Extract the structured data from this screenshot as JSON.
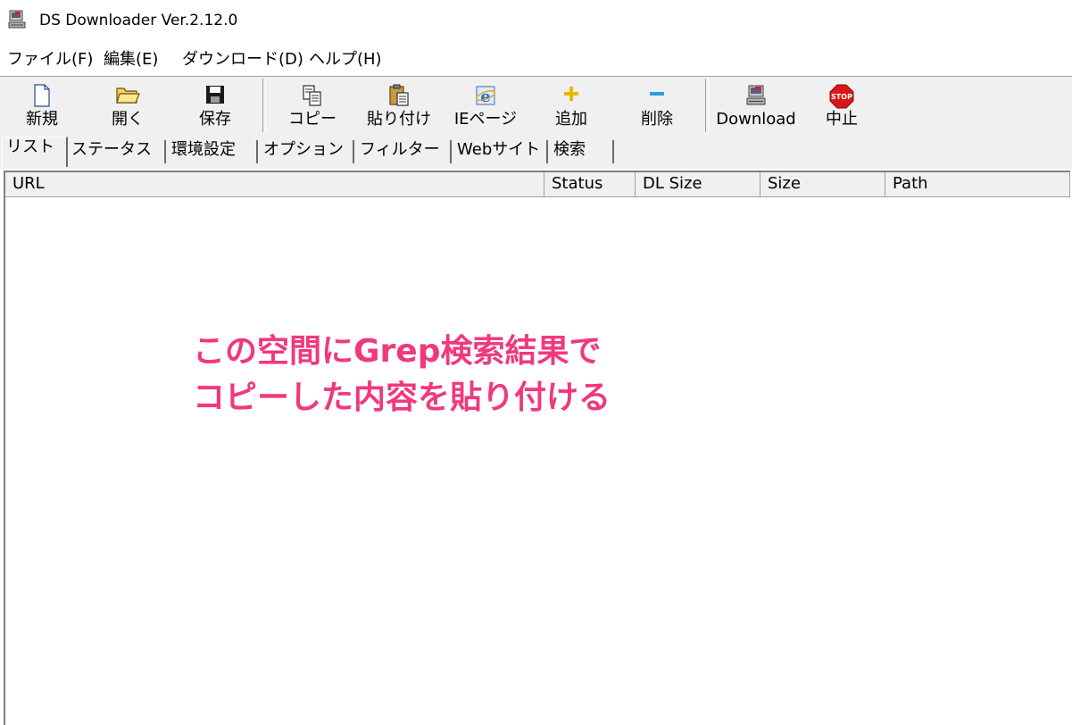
{
  "window": {
    "title": "DS Downloader Ver.2.12.0",
    "icon": "app-computer-icon"
  },
  "menu": [
    {
      "label": "ファイル(F)"
    },
    {
      "label": "編集(E)"
    },
    {
      "label": "ダウンロード(D)"
    },
    {
      "label": "ヘルプ(H)"
    }
  ],
  "toolbar": {
    "new": "新規",
    "open": "開く",
    "save": "保存",
    "copy": "コピー",
    "paste": "貼り付け",
    "iepage": "IEページ",
    "add": "追加",
    "delete": "削除",
    "download": "Download",
    "stop": "中止",
    "stop_sign": "STOP"
  },
  "tabs": [
    {
      "label": "リスト",
      "active": true
    },
    {
      "label": "ステータス"
    },
    {
      "label": "環境設定"
    },
    {
      "label": "オプション"
    },
    {
      "label": "フィルター"
    },
    {
      "label": "Webサイト"
    },
    {
      "label": "検索"
    }
  ],
  "columns": [
    "URL",
    "Status",
    "DL Size",
    "Size",
    "Path"
  ],
  "annotation": {
    "line1": "この空間にGrep検索結果で",
    "line2": "コピーした内容を貼り付ける",
    "color": "#f0397d"
  }
}
